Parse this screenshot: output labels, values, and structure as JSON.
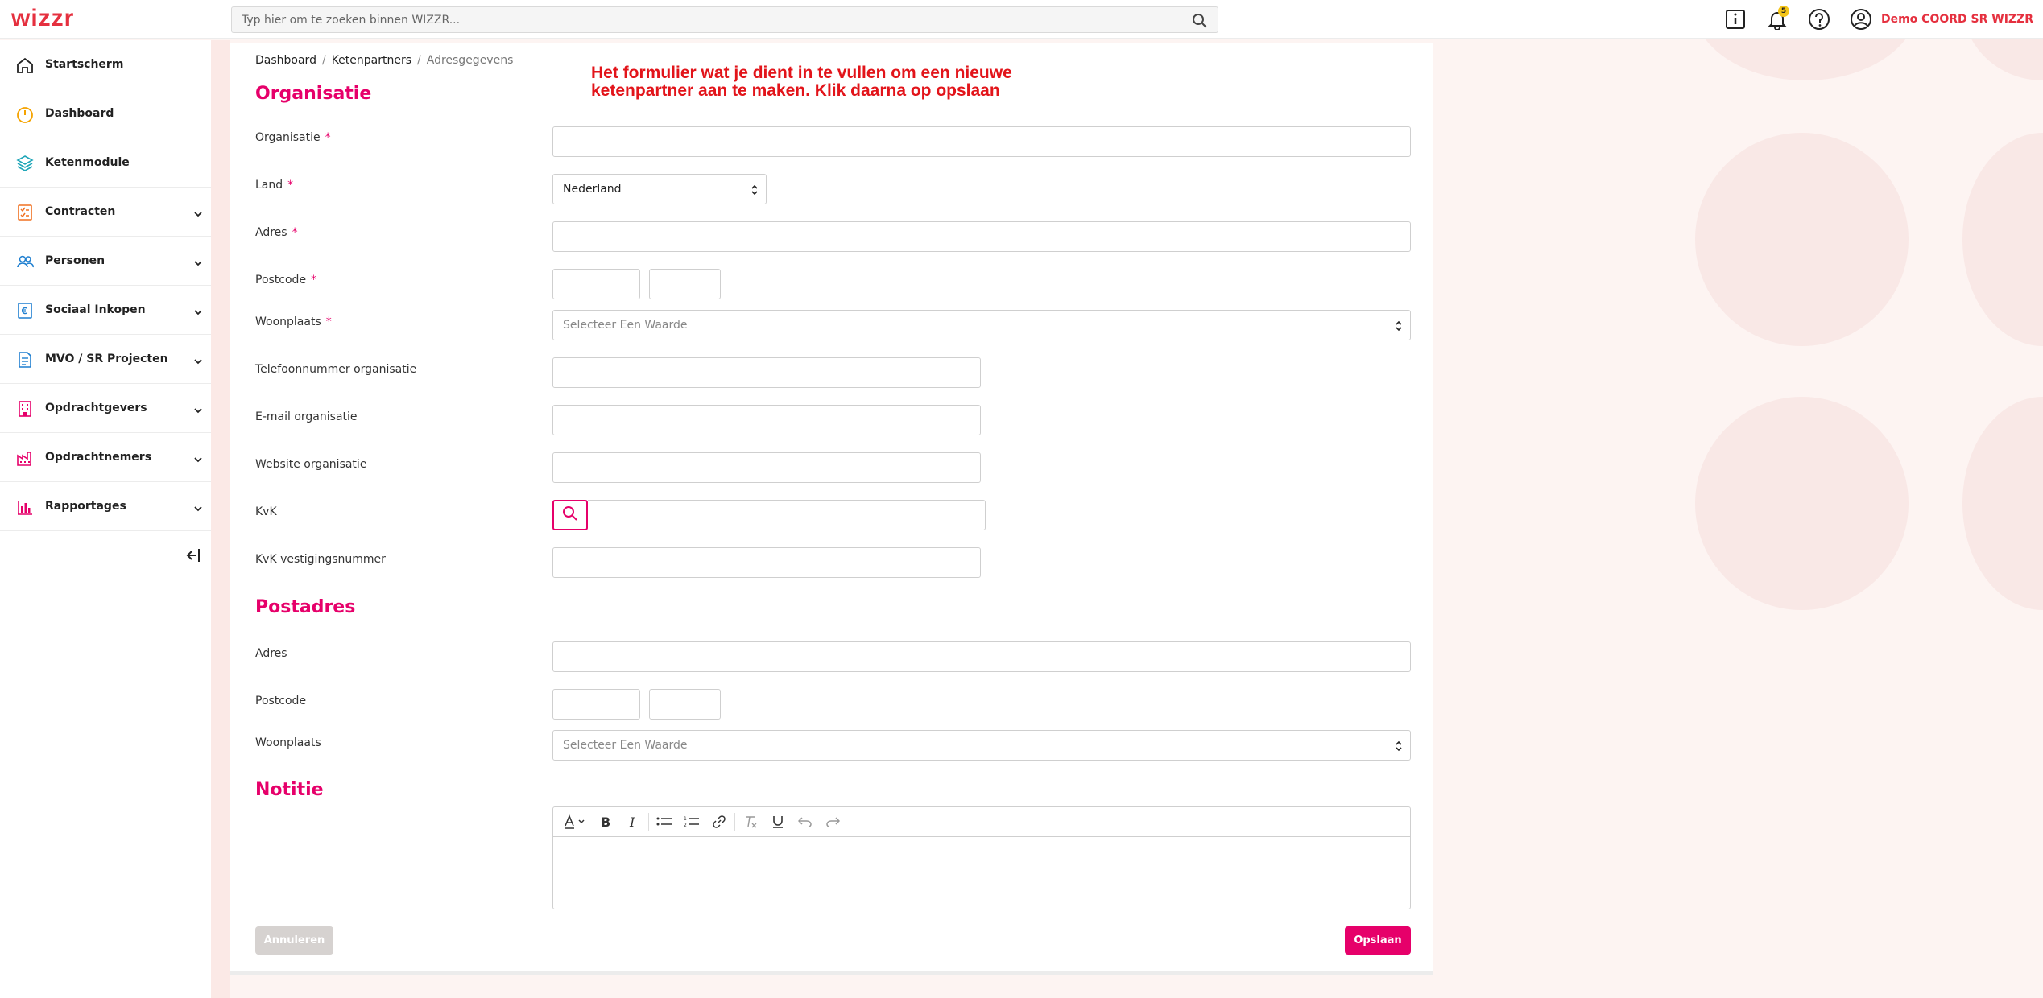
{
  "app": {
    "logo": "wizzr"
  },
  "search": {
    "placeholder": "Typ hier om te zoeken binnen WIZZR..."
  },
  "header": {
    "notifications_count": "5",
    "user_name": "Demo COORD SR WIZZR"
  },
  "sidebar": {
    "items": [
      {
        "label": "Startscherm",
        "icon": "home-icon",
        "color": "#222222",
        "has_chevron": false
      },
      {
        "label": "Dashboard",
        "icon": "gauge-icon",
        "color": "#f5a300",
        "has_chevron": false
      },
      {
        "label": "Ketenmodule",
        "icon": "layers-icon",
        "color": "#1fa6b8",
        "has_chevron": false
      },
      {
        "label": "Contracten",
        "icon": "checklist-icon",
        "color": "#f07020",
        "has_chevron": true
      },
      {
        "label": "Personen",
        "icon": "users-icon",
        "color": "#1f7fd0",
        "has_chevron": true
      },
      {
        "label": "Sociaal Inkopen",
        "icon": "euro-doc-icon",
        "color": "#1f7fd0",
        "has_chevron": true
      },
      {
        "label": "MVO / SR Projecten",
        "icon": "document-icon",
        "color": "#1f7fd0",
        "has_chevron": true
      },
      {
        "label": "Opdrachtgevers",
        "icon": "building-icon",
        "color": "#e6006a",
        "has_chevron": true
      },
      {
        "label": "Opdrachtnemers",
        "icon": "factory-icon",
        "color": "#e6006a",
        "has_chevron": true
      },
      {
        "label": "Rapportages",
        "icon": "bar-chart-icon",
        "color": "#e6006a",
        "has_chevron": true
      }
    ]
  },
  "breadcrumb": {
    "items": [
      "Dashboard",
      "Ketenpartners",
      "Adresgegevens"
    ]
  },
  "annotation": {
    "line1": "Het formulier wat je dient in te vullen om een nieuwe",
    "line2": "ketenpartner aan te maken. Klik daarna op opslaan"
  },
  "form": {
    "section_organisatie": "Organisatie",
    "labels": {
      "organisatie": "Organisatie",
      "land": "Land",
      "adres": "Adres",
      "postcode": "Postcode",
      "woonplaats": "Woonplaats",
      "telefoon": "Telefoonnummer organisatie",
      "email": "E-mail organisatie",
      "website": "Website organisatie",
      "kvk": "KvK",
      "kvk_vestiging": "KvK vestigingsnummer"
    },
    "required_mark": "*",
    "land_value": "Nederland",
    "select_placeholder": "Selecteer Een Waarde",
    "section_postadres": "Postadres",
    "post_labels": {
      "adres": "Adres",
      "postcode": "Postcode",
      "woonplaats": "Woonplaats"
    },
    "section_notitie": "Notitie"
  },
  "buttons": {
    "cancel": "Annuleren",
    "save": "Opslaan"
  },
  "colors": {
    "brand": "#e5303f",
    "accent": "#e6006a"
  }
}
